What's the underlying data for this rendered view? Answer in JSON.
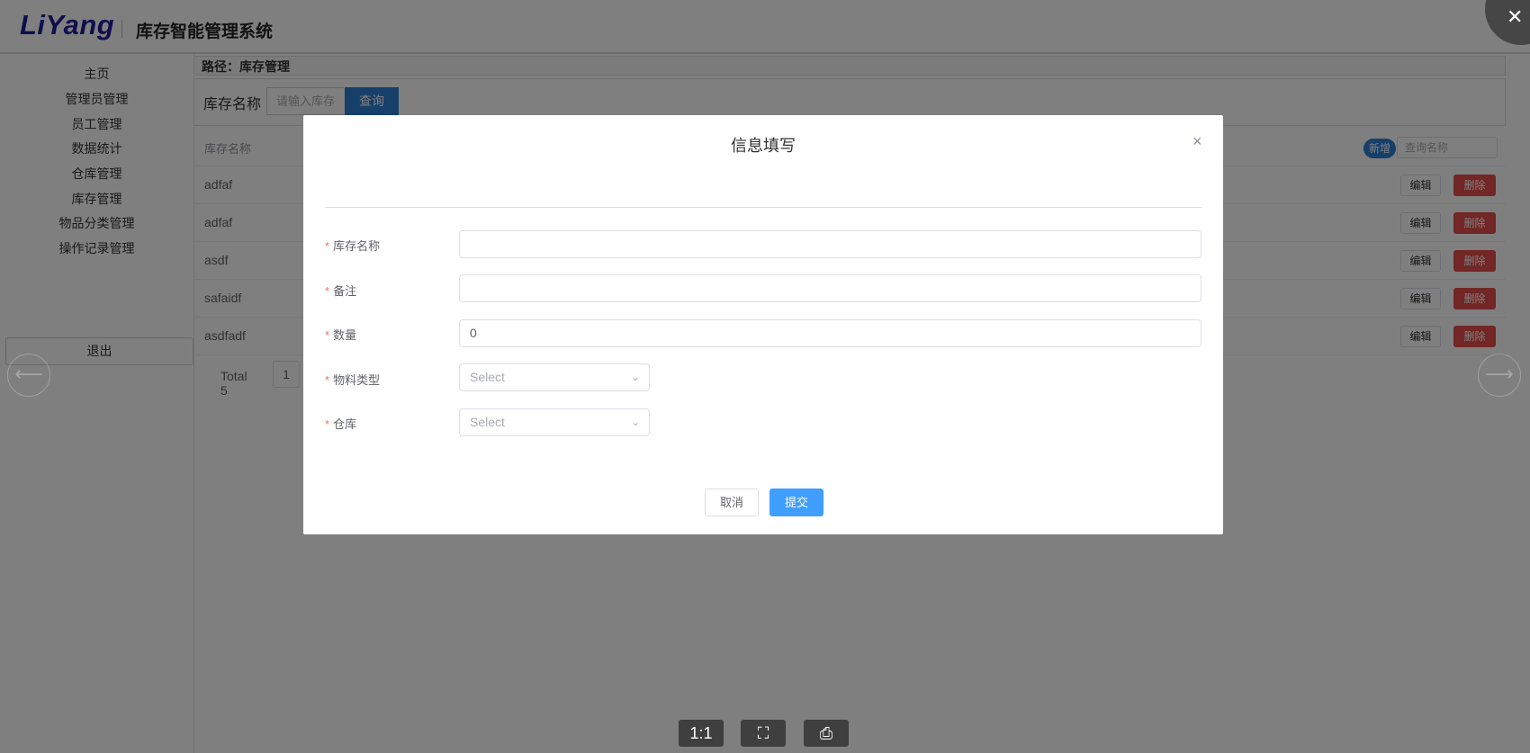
{
  "header": {
    "logo": "LiYang",
    "system_title": "库存智能管理系统"
  },
  "sidebar": {
    "items": [
      {
        "label": "主页"
      },
      {
        "label": "管理员管理"
      },
      {
        "label": "员工管理"
      },
      {
        "label": "数据统计"
      },
      {
        "label": "仓库管理"
      },
      {
        "label": "库存管理"
      },
      {
        "label": "物品分类管理"
      },
      {
        "label": "操作记录管理"
      }
    ],
    "logout_label": "退出"
  },
  "main": {
    "path": "路径：库存管理",
    "search": {
      "label": "库存名称",
      "placeholder": "请输入库存",
      "button": "查询"
    },
    "table": {
      "column_name": "库存名称",
      "add_label": "新增",
      "search_placeholder": "查询名称",
      "rows": [
        {
          "name": "adfaf"
        },
        {
          "name": "adfaf"
        },
        {
          "name": "asdf"
        },
        {
          "name": "safaidf"
        },
        {
          "name": "asdfadf"
        }
      ],
      "edit_label": "编辑",
      "delete_label": "删除"
    },
    "pagination": {
      "total": "Total 5",
      "page": "1"
    }
  },
  "modal": {
    "title": "信息填写",
    "close_symbol": "×",
    "fields": [
      {
        "label": "库存名称",
        "value": "",
        "type": "input"
      },
      {
        "label": "备注",
        "value": "",
        "type": "input"
      },
      {
        "label": "数量",
        "value": "0",
        "type": "input"
      },
      {
        "label": "物料类型",
        "placeholder": "Select",
        "type": "select"
      },
      {
        "label": "仓库",
        "placeholder": "Select",
        "type": "select"
      }
    ],
    "required_mark": "*",
    "cancel_label": "取消",
    "submit_label": "提交"
  },
  "viewer": {
    "close_symbol": "✕",
    "toolbar": [
      {
        "label": "1:1"
      },
      {
        "label": "⛶"
      },
      {
        "label": "⎙"
      }
    ],
    "prev_icon": "⟵",
    "next_icon": "⟶"
  },
  "colors": {
    "primary": "#409eff",
    "danger": "#e74c4c",
    "logo": "#1d1d9b"
  }
}
